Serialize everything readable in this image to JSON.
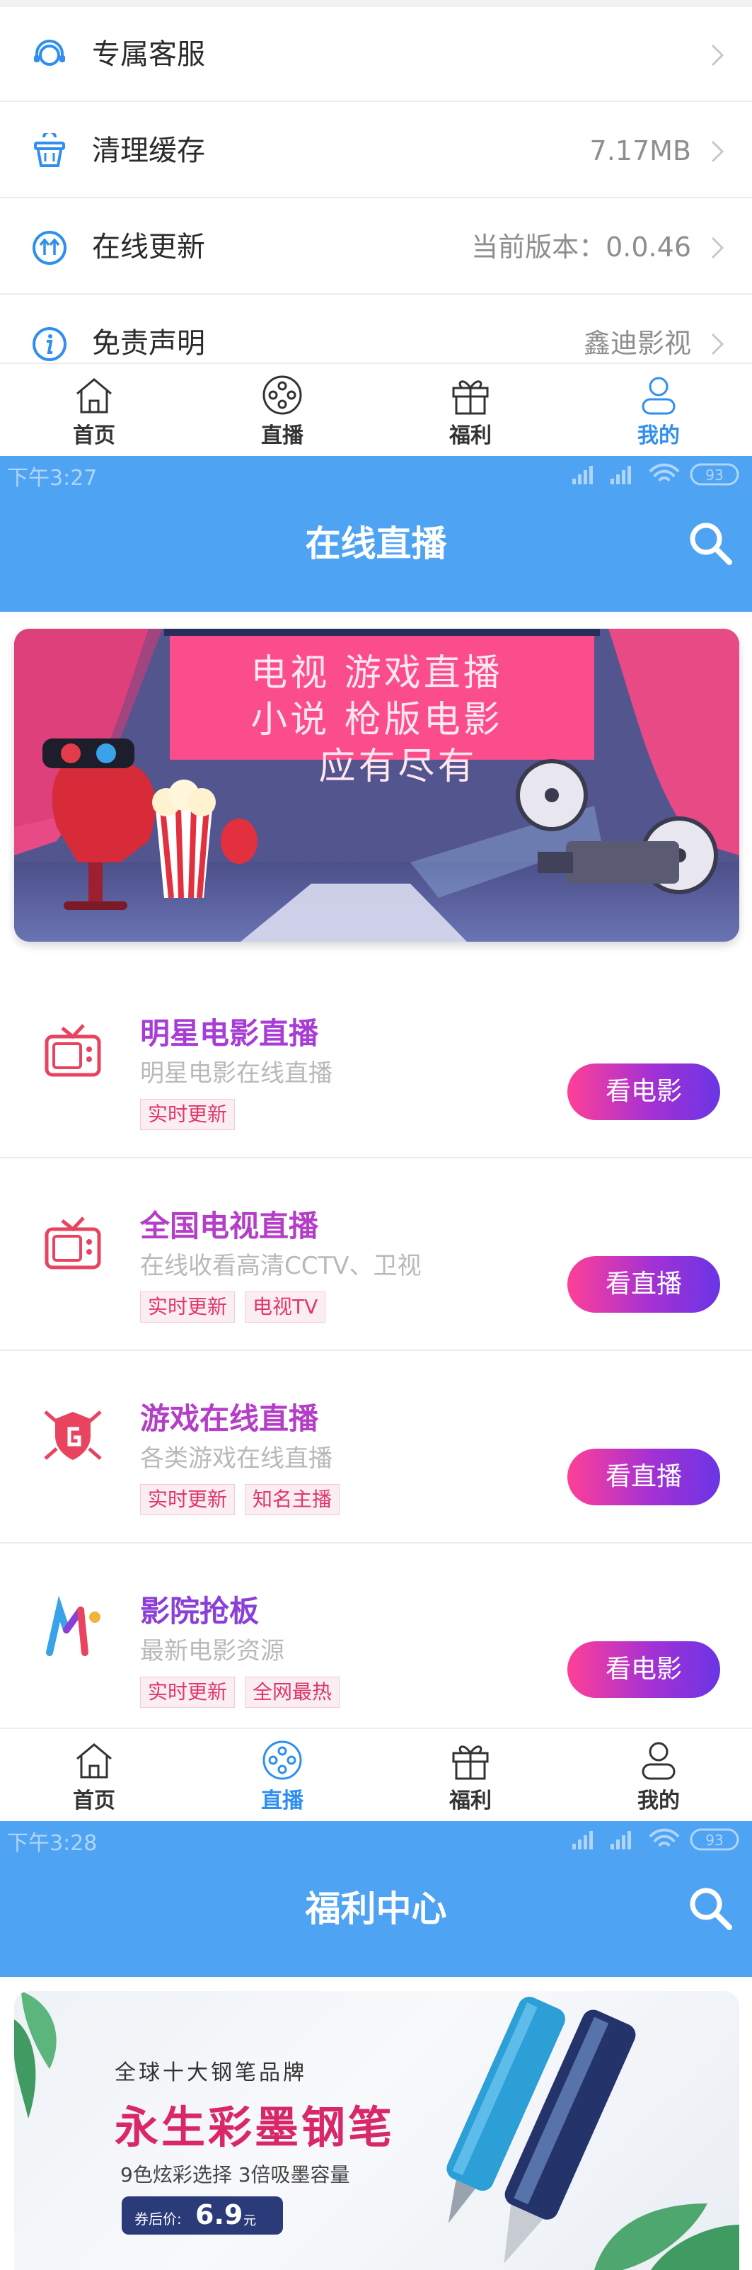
{
  "settings": {
    "items": [
      {
        "label": "专属客服",
        "value": "",
        "icon": "headset-icon"
      },
      {
        "label": "清理缓存",
        "value": "7.17MB",
        "icon": "basket-icon"
      },
      {
        "label": "在线更新",
        "value": "当前版本：0.0.46",
        "icon": "update-icon"
      },
      {
        "label": "免责声明",
        "value": "鑫迪影视",
        "icon": "info-icon"
      }
    ]
  },
  "tabbar1": {
    "tabs": [
      "首页",
      "直播",
      "福利",
      "我的"
    ],
    "active": "我的"
  },
  "screen2": {
    "status_time": "下午3:27",
    "battery": "93",
    "title": "在线直播",
    "banner_lines": [
      "电视  游戏直播",
      "小说  枪版电影",
      "应有尽有"
    ],
    "items": [
      {
        "title": "明星电影直播",
        "desc": "明星电影在线直播",
        "tags": [
          "实时更新"
        ],
        "button": "看电影",
        "title_color": "#a83cd6"
      },
      {
        "title": "全国电视直播",
        "desc": "在线收看高清CCTV、卫视",
        "tags": [
          "实时更新",
          "电视TV"
        ],
        "button": "看直播",
        "title_color": "#b43ec8"
      },
      {
        "title": "游戏在线直播",
        "desc": "各类游戏在线直播",
        "tags": [
          "实时更新",
          "知名主播"
        ],
        "button": "看直播",
        "title_color": "#b43ec8"
      },
      {
        "title": "影院抢板",
        "desc": "最新电影资源",
        "tags": [
          "实时更新",
          "全网最热"
        ],
        "button": "看电影",
        "title_color": "#8b3fd6"
      }
    ]
  },
  "tabbar2": {
    "tabs": [
      "首页",
      "直播",
      "福利",
      "我的"
    ],
    "active": "直播"
  },
  "screen3": {
    "status_time": "下午3:28",
    "battery": "93",
    "title": "福利中心",
    "banner": {
      "brand_line": "全球十大钢笔品牌",
      "headline": "永生彩墨钢笔",
      "subline": "9色炫彩选择 3倍吸墨容量",
      "price_label": "券后价:",
      "price": "6.9",
      "price_unit": "元"
    }
  },
  "colors": {
    "accent": "#4fa3f3",
    "tab_active": "#2f8ff0",
    "button_start": "#ff3f97",
    "button_end": "#6a35e4",
    "tag": "#e0376a"
  }
}
